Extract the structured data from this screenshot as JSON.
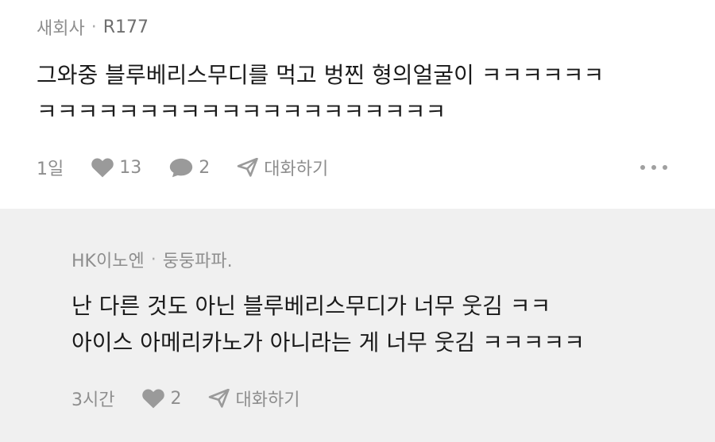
{
  "comment": {
    "author": "새회사",
    "separator": "·",
    "rank": "R177",
    "text": "그와중 블루베리스무디를 먹고 벙찐 형의얼굴이 ㅋㅋㅋㅋㅋㅋ\nㅋㅋㅋㅋㅋㅋㅋㅋㅋㅋㅋㅋㅋㅋㅋㅋㅋㅋㅋㅋ",
    "time": "1일",
    "likes": "13",
    "replies": "2",
    "reply_label": "대화하기"
  },
  "reply": {
    "author": "HK이노엔",
    "separator": "·",
    "reply_to": "둥둥파파.",
    "text": "난 다른 것도 아닌 블루베리스무디가 너무 웃김 ㅋㅋ\n아이스 아메리카노가 아니라는 게 너무 웃김 ㅋㅋㅋㅋㅋ",
    "time": "3시간",
    "likes": "2",
    "reply_label": "대화하기"
  },
  "icons": {
    "heart": "heart-icon",
    "comment": "comment-bubble-icon",
    "send": "paper-plane-icon",
    "more": "more-dots-icon"
  },
  "colors": {
    "meta_gray": "#8e8e8e",
    "reply_background": "#f0f0f0",
    "text": "#1a1a1a"
  }
}
